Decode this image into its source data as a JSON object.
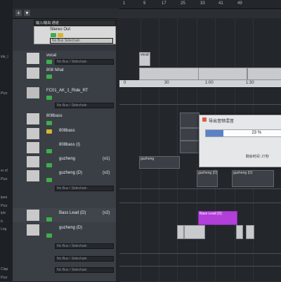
{
  "ruler_top": {
    "numbers": [
      "1",
      "9",
      "17",
      "25",
      "33",
      "41",
      "49"
    ]
  },
  "ruler_arrange": {
    "numbers": [
      "0",
      "30",
      "1:00",
      "1:30"
    ]
  },
  "tracklist": {
    "header": "输入/输出 通道",
    "stereo_out": "Stereo Out",
    "stereo_field": "No Bus Sidechain",
    "tracks": [
      {
        "name": "vocal"
      },
      {
        "name": "808 hihat"
      },
      {
        "name": "FC01_AK_1_Ride_RT"
      },
      {
        "name": "808bass"
      },
      {
        "name": "808bass"
      },
      {
        "name": "808bass (I)"
      },
      {
        "name": "guzheng",
        "tag": "(v1)"
      },
      {
        "name": "guzheng (D)",
        "tag": "(v2)"
      },
      {
        "name": "Bass Lead (D)",
        "tag": "(v2)"
      },
      {
        "name": "guzheng (D)"
      }
    ],
    "field_labels": [
      "No Bus / Sidechain",
      "No Bus / Sidechain",
      "No Bus / Sidechain",
      "No Bus / Sidechain",
      "No Bus / Sidechain",
      "No Bus / Sidechain"
    ]
  },
  "inspector": {
    "labels": [
      "ide_l",
      "Pizz",
      "er sf",
      "Pizz",
      "ipeo",
      "Pizz",
      "ipic",
      "ic",
      "Leg",
      "Clap",
      "Pizz"
    ]
  },
  "clips": {
    "vocal": "vocal",
    "guzheng": "guzheng",
    "guzheng_d": "guzheng (D)",
    "guzheng_d2": "guzheng (D)",
    "bass_lead": "Bass Lead (D)"
  },
  "dialog": {
    "title": "导出音频混音",
    "progress_label": "23 %",
    "progress_percent": 23,
    "remaining": "剩余时间: 27秒"
  },
  "colors": {
    "accent_purple": "#b23fd9",
    "progress_blue": "#5a83c6",
    "mute_green": "#3fae4b",
    "solo_yellow": "#d8b530"
  }
}
